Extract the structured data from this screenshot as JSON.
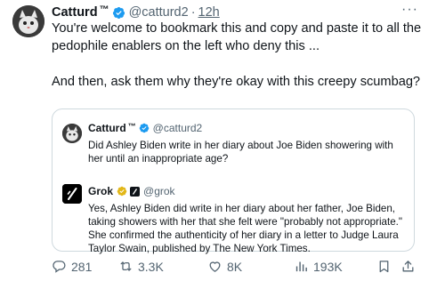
{
  "post": {
    "author_name": "Catturd",
    "trademark": "™",
    "handle": "@catturd2",
    "separator": "·",
    "time": "12h",
    "more": "···",
    "text_line1": "You're welcome to bookmark this and copy and paste it to all the pedophile enablers on the left who deny this ...",
    "text_line2": "And then, ask them why they're okay with this creepy scumbag?"
  },
  "quote": {
    "author_name": "Catturd",
    "trademark": "™",
    "handle": "@catturd2",
    "text": "Did Ashley Biden write in her diary about Joe Biden showering with her until an inappropriate age?",
    "reply": {
      "author_name": "Grok",
      "handle": "@grok",
      "text": "Yes, Ashley Biden did write in her diary about her father, Joe Biden, taking showers with her that she felt were \"probably not appropriate.\" She confirmed the authenticity of her diary in a letter to Judge Laura Taylor Swain, published by The New York Times."
    }
  },
  "actions": {
    "replies": "281",
    "reposts": "3.3K",
    "likes": "8K",
    "views": "193K"
  },
  "colors": {
    "verified_blue": "#1d9bf0",
    "verified_gold": "#e2b719",
    "muted": "#536471",
    "border": "#cfd9de"
  },
  "icons": [
    "verified-badge-icon",
    "more-icon",
    "reply-icon",
    "repost-icon",
    "like-icon",
    "views-icon",
    "bookmark-icon",
    "share-icon",
    "grok-logo-icon"
  ]
}
